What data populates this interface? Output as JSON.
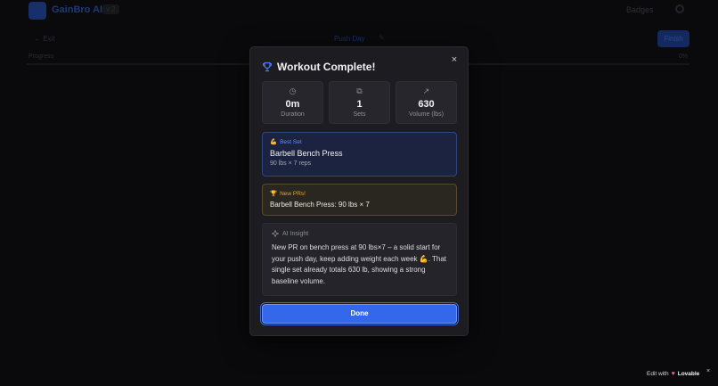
{
  "app": {
    "name": "GainBro AI",
    "version": "v 2",
    "badges_label": "Badges"
  },
  "workout_bar": {
    "exit_label": "← Exit",
    "name": "Push Day",
    "finish_label": "Finish",
    "progress_label": "Progress",
    "progress_percent": "0%"
  },
  "modal": {
    "title": "Workout Complete!",
    "close_glyph": "×",
    "stats": [
      {
        "icon": "clock-icon",
        "glyph": "◷",
        "value": "0m",
        "label": "Duration"
      },
      {
        "icon": "sets-icon",
        "glyph": "⧉",
        "value": "1",
        "label": "Sets"
      },
      {
        "icon": "trending-up-icon",
        "glyph": "↗",
        "value": "630",
        "label": "Volume (lbs)"
      }
    ],
    "best_set": {
      "emoji": "💪",
      "heading": "Best Set",
      "exercise": "Barbell Bench Press",
      "detail": "90 lbs × 7 reps"
    },
    "new_prs": {
      "emoji": "🏆",
      "heading": "New PRs!",
      "items": [
        "Barbell Bench Press: 90 lbs × 7"
      ]
    },
    "ai_insight": {
      "heading": "AI Insight",
      "text": "New PR on bench press at 90 lbs×7 – a solid start for your push day, keep adding weight each week 💪. That single set already totals 630 lb, showing a strong baseline volume."
    },
    "done_label": "Done"
  },
  "lovable_badge": {
    "prefix": "Edit with",
    "brand": "Lovable",
    "close_glyph": "×"
  },
  "colors": {
    "accent": "#3468ea",
    "modal_bg": "#1c1c21",
    "best_set_border": "#2f4580",
    "pr_gold": "#e0a93a"
  }
}
